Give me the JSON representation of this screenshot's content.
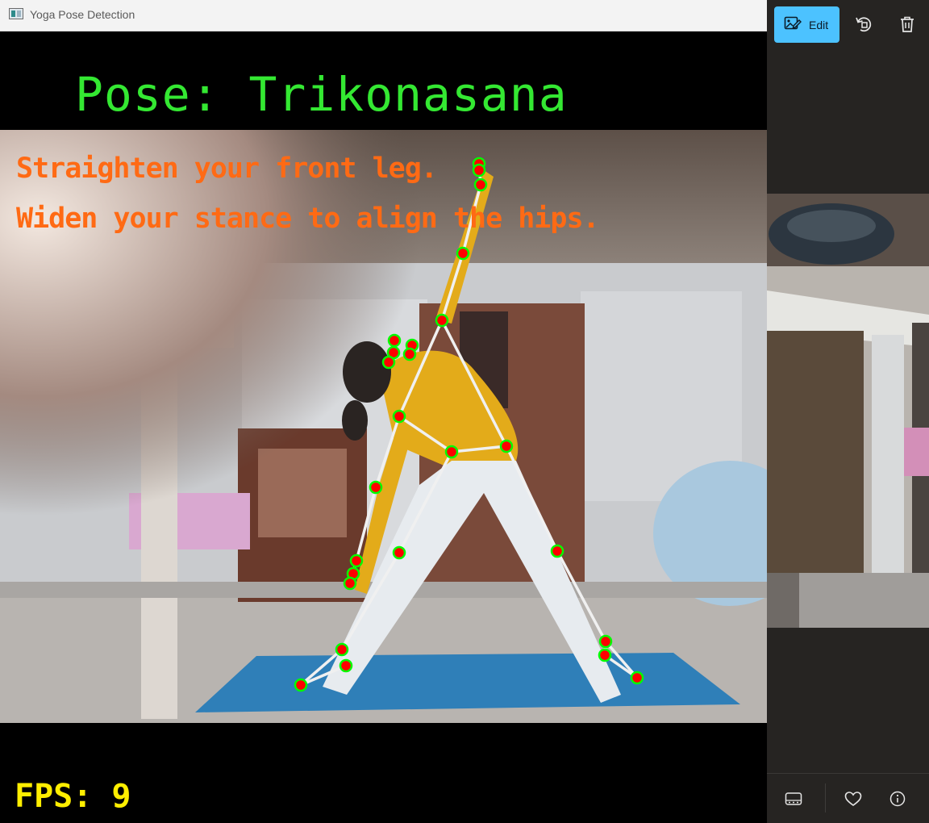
{
  "window": {
    "title": "Yoga Pose Detection"
  },
  "overlay": {
    "pose_text": "Pose: Trikonasana",
    "feedback": [
      "Straighten your front leg.",
      "Widen your stance to align the hips."
    ],
    "fps_text": "FPS: 9",
    "colors": {
      "pose": "#34e832",
      "feedback": "#ff6a14",
      "fps": "#ffee00",
      "keypoint": "#ff0000",
      "keypoint_ring": "#00ff00",
      "skeleton": "#f0f0f0"
    }
  },
  "viewer": {
    "toolbar": {
      "edit_label": "Edit",
      "edit_icon": "edit-photo-icon",
      "rotate_icon": "rotate-icon",
      "delete_icon": "trash-icon"
    },
    "bottom_bar": {
      "filmstrip_icon": "filmstrip-icon",
      "favorite_icon": "heart-icon",
      "info_icon": "info-icon"
    },
    "accent": "#4cc2ff"
  }
}
